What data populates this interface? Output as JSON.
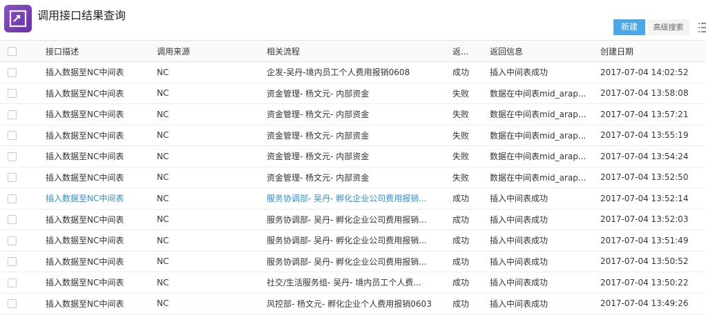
{
  "page": {
    "title": "调用接口结果查询",
    "app_icon": "sync-arrows-icon",
    "accent_color": "#7a43b8",
    "primary_button_color": "#4ba7e8"
  },
  "toolbar": {
    "new_label": "新建",
    "advanced_search_label": "高级搜索",
    "menu_icon": "list-menu-icon"
  },
  "table": {
    "headers": {
      "description": "接口描述",
      "source": "调用来源",
      "process": "相关流程",
      "status": "返...",
      "message": "返回信息",
      "created": "创建日期"
    },
    "rows": [
      {
        "description": "插入数据至NC中间表",
        "source": "NC",
        "process": "企发-吴丹-境内员工个人费用报销0608",
        "status": "成功",
        "message": "插入中间表成功",
        "created": "2017-07-04 14:02:52"
      },
      {
        "description": "插入数据至NC中间表",
        "source": "NC",
        "process": "资金管理- 杨文元- 内部资金",
        "status": "失败",
        "message": "数据在中间表mid_arap...",
        "created": "2017-07-04 13:58:08"
      },
      {
        "description": "插入数据至NC中间表",
        "source": "NC",
        "process": "资金管理- 杨文元- 内部资金",
        "status": "失败",
        "message": "数据在中间表mid_arap...",
        "created": "2017-07-04 13:57:21"
      },
      {
        "description": "插入数据至NC中间表",
        "source": "NC",
        "process": "资金管理- 杨文元- 内部资金",
        "status": "失败",
        "message": "数据在中间表mid_arap...",
        "created": "2017-07-04 13:55:19"
      },
      {
        "description": "插入数据至NC中间表",
        "source": "NC",
        "process": "资金管理- 杨文元- 内部资金",
        "status": "失败",
        "message": "数据在中间表mid_arap...",
        "created": "2017-07-04 13:54:24"
      },
      {
        "description": "插入数据至NC中间表",
        "source": "NC",
        "process": "资金管理- 杨文元- 内部资金",
        "status": "失败",
        "message": "数据在中间表mid_arap...",
        "created": "2017-07-04 13:52:50"
      },
      {
        "description": "插入数据至NC中间表",
        "source": "NC",
        "process": "服务协调部- 吴丹- 孵化企业公司费用报销...",
        "status": "成功",
        "message": "插入中间表成功",
        "created": "2017-07-04 13:52:14",
        "highlighted": true
      },
      {
        "description": "插入数据至NC中间表",
        "source": "NC",
        "process": "服务协调部- 吴丹- 孵化企业公司费用报销...",
        "status": "成功",
        "message": "插入中间表成功",
        "created": "2017-07-04 13:52:03"
      },
      {
        "description": "插入数据至NC中间表",
        "source": "NC",
        "process": "服务协调部- 吴丹- 孵化企业公司费用报销...",
        "status": "成功",
        "message": "插入中间表成功",
        "created": "2017-07-04 13:51:49"
      },
      {
        "description": "插入数据至NC中间表",
        "source": "NC",
        "process": "服务协调部- 吴丹- 孵化企业公司费用报销...",
        "status": "成功",
        "message": "插入中间表成功",
        "created": "2017-07-04 13:50:52"
      },
      {
        "description": "插入数据至NC中间表",
        "source": "NC",
        "process": "社交/生活服务组- 吴丹- 境内员工个人费...",
        "status": "成功",
        "message": "插入中间表成功",
        "created": "2017-07-04 13:50:22"
      },
      {
        "description": "插入数据至NC中间表",
        "source": "NC",
        "process": "风控部- 杨文元- 孵化企业个人费用报销0603",
        "status": "成功",
        "message": "插入中间表成功",
        "created": "2017-07-04 13:49:26"
      }
    ]
  }
}
